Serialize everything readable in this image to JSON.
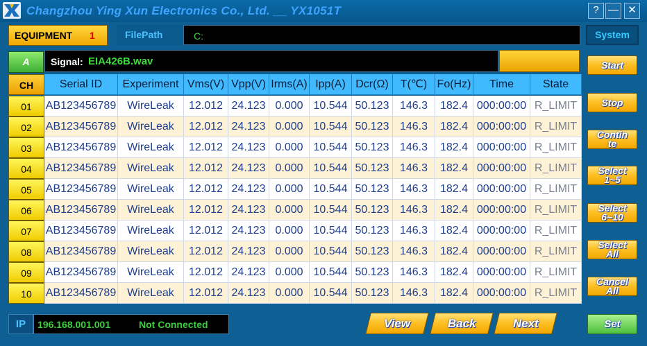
{
  "window": {
    "title": "Changzhou Ying Xun Electronics Co., Ltd. __  YX1051T",
    "help_symbol": "?",
    "minimize_symbol": "—",
    "close_symbol": "✕"
  },
  "equipment": {
    "label": "EQUIPMENT",
    "number": "1"
  },
  "filepath": {
    "label": "FilePath",
    "value": "C:"
  },
  "system_button": "System",
  "channel_button": "A",
  "signal": {
    "label": "Signal:",
    "value": "EIA426B.wav"
  },
  "table": {
    "headers": [
      "CH",
      "Serial ID",
      "Experiment",
      "Vms(V)",
      "Vpp(V)",
      "Irms(A)",
      "Ipp(A)",
      "Dcr(Ω)",
      "T(℃)",
      "Fo(Hz)",
      "Time",
      "State"
    ],
    "rows": [
      [
        "01",
        "AB123456789",
        "WireLeak",
        "12.012",
        "24.123",
        "0.000",
        "10.544",
        "50.123",
        "146.3",
        "182.4",
        "000:00:00",
        "R_LIMIT"
      ],
      [
        "02",
        "AB123456789",
        "WireLeak",
        "12.012",
        "24.123",
        "0.000",
        "10.544",
        "50.123",
        "146.3",
        "182.4",
        "000:00:00",
        "R_LIMIT"
      ],
      [
        "03",
        "AB123456789",
        "WireLeak",
        "12.012",
        "24.123",
        "0.000",
        "10.544",
        "50.123",
        "146.3",
        "182.4",
        "000:00:00",
        "R_LIMIT"
      ],
      [
        "04",
        "AB123456789",
        "WireLeak",
        "12.012",
        "24.123",
        "0.000",
        "10.544",
        "50.123",
        "146.3",
        "182.4",
        "000:00:00",
        "R_LIMIT"
      ],
      [
        "05",
        "AB123456789",
        "WireLeak",
        "12.012",
        "24.123",
        "0.000",
        "10.544",
        "50.123",
        "146.3",
        "182.4",
        "000:00:00",
        "R_LIMIT"
      ],
      [
        "06",
        "AB123456789",
        "WireLeak",
        "12.012",
        "24.123",
        "0.000",
        "10.544",
        "50.123",
        "146.3",
        "182.4",
        "000:00:00",
        "R_LIMIT"
      ],
      [
        "07",
        "AB123456789",
        "WireLeak",
        "12.012",
        "24.123",
        "0.000",
        "10.544",
        "50.123",
        "146.3",
        "182.4",
        "000:00:00",
        "R_LIMIT"
      ],
      [
        "08",
        "AB123456789",
        "WireLeak",
        "12.012",
        "24.123",
        "0.000",
        "10.544",
        "50.123",
        "146.3",
        "182.4",
        "000:00:00",
        "R_LIMIT"
      ],
      [
        "09",
        "AB123456789",
        "WireLeak",
        "12.012",
        "24.123",
        "0.000",
        "10.544",
        "50.123",
        "146.3",
        "182.4",
        "000:00:00",
        "R_LIMIT"
      ],
      [
        "10",
        "AB123456789",
        "WireLeak",
        "12.012",
        "24.123",
        "0.000",
        "10.544",
        "50.123",
        "146.3",
        "182.4",
        "000:00:00",
        "R_LIMIT"
      ]
    ]
  },
  "side_buttons": {
    "start": "Start",
    "stop": "Stop",
    "continue_line1": "Contin",
    "continue_line2": "te",
    "select_1_5_line1": "Select",
    "select_1_5_line2": "1~5",
    "select_6_10_line1": "Select",
    "select_6_10_line2": "6~10",
    "select_all_line1": "Select",
    "select_all_line2": "All",
    "cancel_all_line1": "Cancel",
    "cancel_all_line2": "All",
    "set": "Set"
  },
  "bottom": {
    "ip_label": "IP",
    "ip_value": "196.168.001.001",
    "status": "Not Connected",
    "view": "View",
    "back": "Back",
    "next": "Next"
  }
}
